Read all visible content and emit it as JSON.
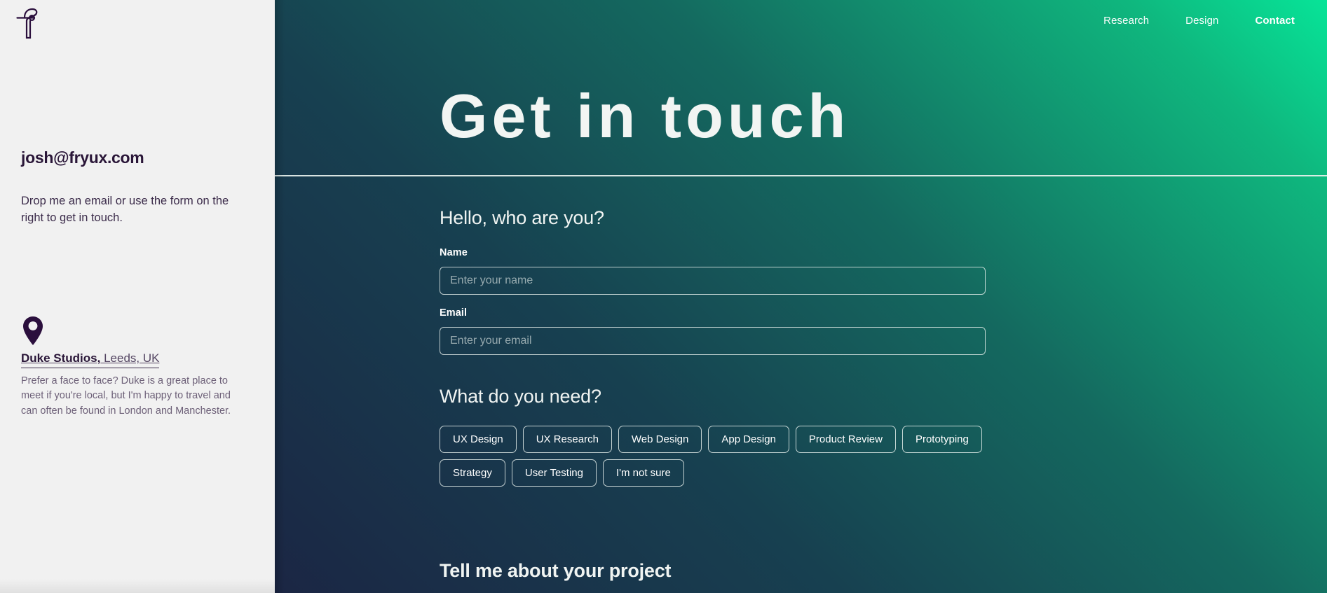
{
  "sidebar": {
    "logo_icon": "fryux-f-logo-icon",
    "email": "josh@fryux.com",
    "intro": "Drop me an email or use the form on the right to get in touch.",
    "pin_icon": "location-pin-icon",
    "address_venue": "Duke Studios,",
    "address_place": " Leeds, UK",
    "address_note": "Prefer a face to face? Duke is a great place to meet if you're local, but I'm happy to travel and can often be found in London and Manchester."
  },
  "nav": {
    "items": [
      {
        "label": "Research",
        "active": false
      },
      {
        "label": "Design",
        "active": false
      },
      {
        "label": "Contact",
        "active": true
      }
    ]
  },
  "hero": {
    "title": "Get in touch"
  },
  "form": {
    "who_are_you_title": "Hello, who are you?",
    "name_label": "Name",
    "name_value": "",
    "name_placeholder": "Enter your name",
    "email_label": "Email",
    "email_value": "",
    "email_placeholder": "Enter your email",
    "needs_title": "What do you need?",
    "needs_options": [
      "UX Design",
      "UX Research",
      "Web Design",
      "App Design",
      "Product Review",
      "Prototyping",
      "Strategy",
      "User Testing",
      "I'm not sure"
    ],
    "project_title": "Tell me about your project"
  },
  "colors": {
    "sidebar_bg": "#f1f1f1",
    "ink": "#2a1638",
    "gradient_dark": "#1b2644",
    "gradient_teal": "#14695f",
    "gradient_green": "#07e498",
    "on_dark_text": "#ffffff"
  }
}
